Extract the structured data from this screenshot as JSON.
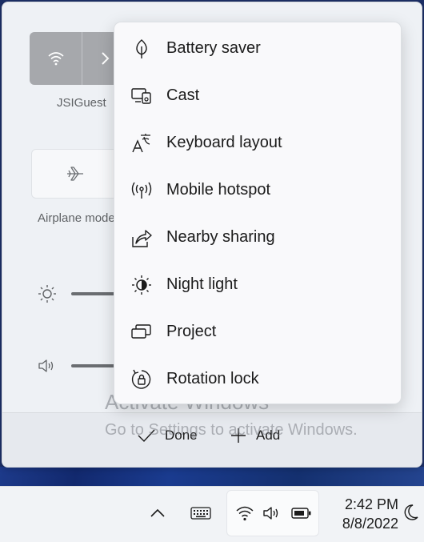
{
  "quick_settings": {
    "wifi_network_label": "JSIGuest",
    "airplane_label": "Airplane mode",
    "done_label": "Done",
    "add_label": "Add"
  },
  "add_menu": {
    "items": [
      {
        "label": "Battery saver",
        "icon": "leaf-icon"
      },
      {
        "label": "Cast",
        "icon": "cast-icon"
      },
      {
        "label": "Keyboard layout",
        "icon": "keyboard-layout-icon"
      },
      {
        "label": "Mobile hotspot",
        "icon": "hotspot-icon"
      },
      {
        "label": "Nearby sharing",
        "icon": "share-icon"
      },
      {
        "label": "Night light",
        "icon": "night-light-icon"
      },
      {
        "label": "Project",
        "icon": "project-icon"
      },
      {
        "label": "Rotation lock",
        "icon": "rotation-lock-icon"
      }
    ]
  },
  "watermark": {
    "title": "Activate Windows",
    "subtitle": "Go to Settings to activate Windows."
  },
  "taskbar": {
    "time": "2:42 PM",
    "date": "8/8/2022"
  }
}
